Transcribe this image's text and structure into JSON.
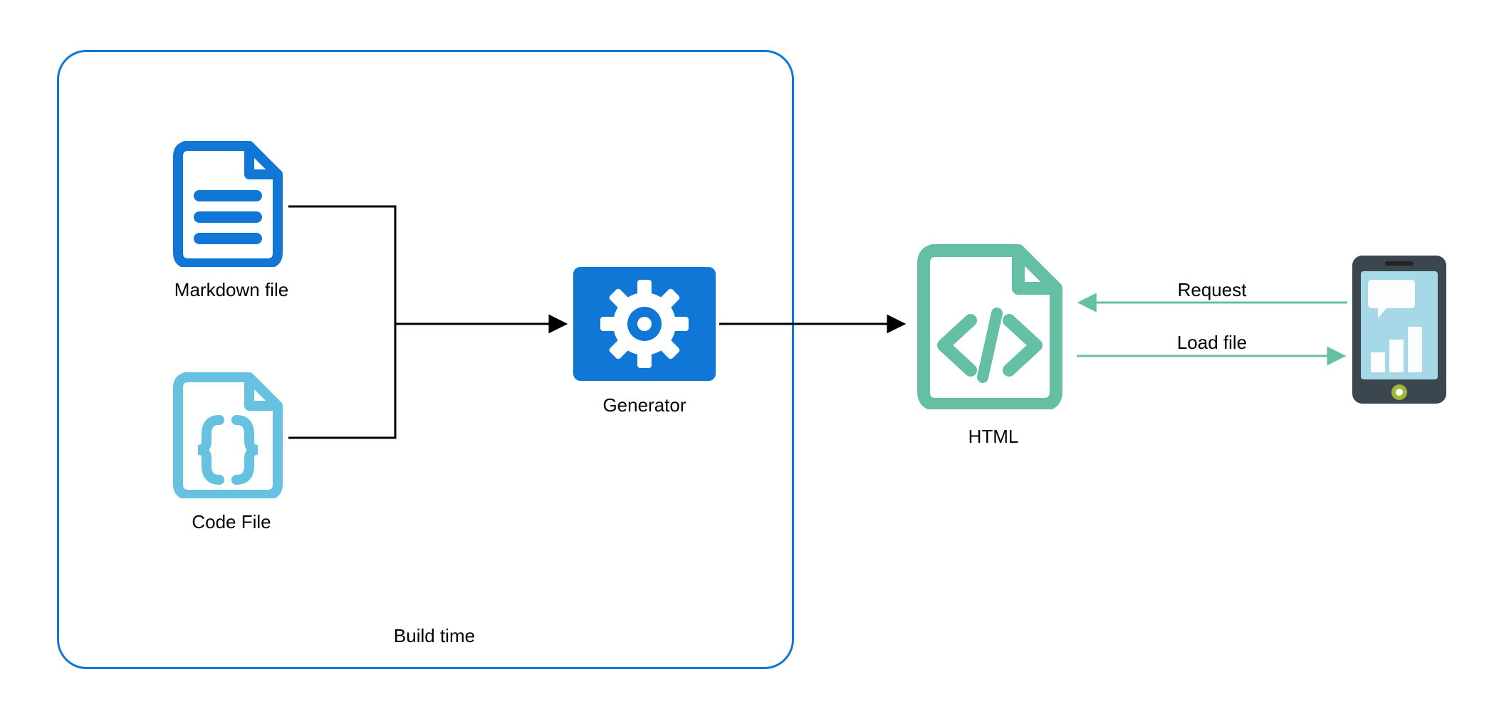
{
  "diagram": {
    "group_label": "Build time",
    "nodes": {
      "markdown": {
        "label": "Markdown file"
      },
      "code": {
        "label": "Code File"
      },
      "generator": {
        "label": "Generator"
      },
      "html": {
        "label": "HTML"
      }
    },
    "edges": {
      "request": {
        "label": "Request"
      },
      "loadfile": {
        "label": "Load file"
      }
    },
    "colors": {
      "blue": "#1177d7",
      "lightblue": "#66c2e0",
      "teal": "#64bfa4",
      "black": "#000000",
      "phone_dark": "#3b464f",
      "phone_lcd": "#a7d8e8",
      "phone_btn": "#9cb836"
    }
  }
}
